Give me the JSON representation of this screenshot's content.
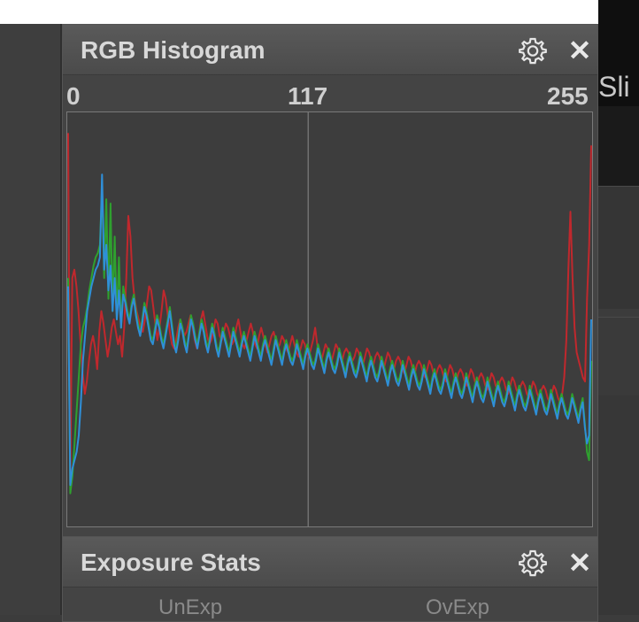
{
  "side_panel": {
    "title": "Sli"
  },
  "histogram_panel": {
    "title": "RGB Histogram",
    "axis": {
      "min": "0",
      "mid": "117",
      "max": "255"
    },
    "icons": {
      "settings": "gear-icon",
      "close": "close-icon"
    },
    "close_glyph": "✕"
  },
  "exposure_panel": {
    "title": "Exposure Stats",
    "close_glyph": "✕",
    "columns": [
      "UnExp",
      "OvExp"
    ]
  },
  "colors": {
    "red": "#c0282d",
    "green": "#2fa02f",
    "blue": "#2f8fd8",
    "grid": "#8a8a8a"
  },
  "chart_data": {
    "type": "line",
    "xlim": [
      0,
      255
    ],
    "x_ticks": [
      0,
      117,
      255
    ],
    "series": [
      {
        "color": "red",
        "values": [
          95,
          10,
          60,
          62,
          58,
          52,
          44,
          37,
          32,
          35,
          40,
          44,
          46,
          43,
          38,
          47,
          52,
          49,
          45,
          41,
          44,
          48,
          50,
          47,
          44,
          46,
          41,
          48,
          60,
          75,
          70,
          60,
          55,
          52,
          50,
          48,
          47,
          50,
          54,
          58,
          57,
          53,
          49,
          45,
          48,
          52,
          57,
          55,
          51,
          47,
          44,
          43,
          45,
          48,
          50,
          48,
          46,
          47,
          49,
          51,
          48,
          45,
          43,
          46,
          50,
          52,
          49,
          46,
          44,
          45,
          47,
          50,
          49,
          46,
          45,
          47,
          49,
          48,
          46,
          44,
          45,
          48,
          50,
          47,
          44,
          43,
          45,
          47,
          49,
          47,
          44,
          43,
          46,
          48,
          46,
          44,
          42,
          44,
          46,
          47,
          45,
          43,
          44,
          46,
          45,
          43,
          42,
          44,
          46,
          44,
          42,
          41,
          43,
          45,
          44,
          42,
          41,
          43,
          45,
          48,
          44,
          42,
          40,
          42,
          44,
          43,
          41,
          40,
          42,
          44,
          43,
          41,
          40,
          42,
          43,
          42,
          41,
          40,
          41,
          43,
          42,
          40,
          39,
          41,
          43,
          42,
          40,
          39,
          41,
          42,
          41,
          39,
          38,
          40,
          42,
          41,
          39,
          38,
          40,
          41,
          40,
          38,
          37,
          39,
          41,
          40,
          38,
          37,
          39,
          40,
          39,
          37,
          36,
          38,
          40,
          39,
          37,
          36,
          38,
          39,
          38,
          36,
          35,
          37,
          39,
          38,
          36,
          35,
          37,
          38,
          37,
          35,
          34,
          36,
          38,
          37,
          35,
          34,
          36,
          37,
          36,
          34,
          33,
          35,
          37,
          36,
          34,
          33,
          35,
          36,
          35,
          33,
          32,
          34,
          36,
          35,
          33,
          32,
          34,
          35,
          34,
          32,
          31,
          33,
          35,
          34,
          32,
          31,
          33,
          34,
          33,
          31,
          30,
          32,
          34,
          33,
          31,
          30,
          32,
          36,
          45,
          62,
          76,
          60,
          48,
          42,
          40,
          38,
          36,
          35,
          55,
          68,
          92
        ]
      },
      {
        "color": "green",
        "values": [
          60,
          8,
          12,
          20,
          28,
          36,
          44,
          48,
          50,
          53,
          57,
          60,
          63,
          65,
          66,
          68,
          82,
          60,
          79,
          55,
          78,
          52,
          70,
          50,
          65,
          48,
          58,
          55,
          52,
          50,
          54,
          56,
          52,
          49,
          47,
          50,
          54,
          52,
          49,
          46,
          45,
          48,
          51,
          49,
          46,
          44,
          47,
          50,
          53,
          49,
          45,
          43,
          46,
          50,
          48,
          45,
          43,
          47,
          51,
          49,
          46,
          44,
          47,
          50,
          48,
          45,
          43,
          46,
          49,
          47,
          44,
          42,
          45,
          48,
          46,
          44,
          42,
          45,
          48,
          46,
          44,
          42,
          45,
          47,
          45,
          43,
          41,
          44,
          47,
          45,
          43,
          41,
          44,
          46,
          44,
          42,
          40,
          43,
          46,
          44,
          42,
          40,
          43,
          45,
          43,
          41,
          40,
          42,
          45,
          43,
          41,
          39,
          42,
          44,
          42,
          40,
          39,
          41,
          44,
          42,
          40,
          38,
          41,
          43,
          41,
          39,
          38,
          40,
          43,
          41,
          39,
          37,
          40,
          42,
          40,
          38,
          37,
          39,
          42,
          40,
          38,
          36,
          39,
          41,
          39,
          37,
          36,
          38,
          41,
          39,
          37,
          35,
          38,
          40,
          38,
          36,
          35,
          37,
          40,
          38,
          36,
          34,
          37,
          39,
          37,
          35,
          34,
          36,
          39,
          37,
          35,
          33,
          36,
          38,
          36,
          34,
          33,
          35,
          38,
          36,
          34,
          32,
          35,
          37,
          35,
          33,
          32,
          34,
          37,
          35,
          33,
          31,
          34,
          36,
          34,
          32,
          31,
          33,
          36,
          34,
          32,
          30,
          33,
          35,
          33,
          31,
          30,
          32,
          35,
          33,
          31,
          29,
          32,
          34,
          32,
          30,
          29,
          31,
          34,
          32,
          30,
          28,
          31,
          33,
          31,
          29,
          28,
          30,
          33,
          31,
          29,
          27,
          30,
          32,
          30,
          28,
          27,
          29,
          32,
          30,
          28,
          26,
          29,
          31,
          25,
          18,
          16,
          40
        ]
      },
      {
        "color": "blue",
        "values": [
          58,
          10,
          14,
          16,
          18,
          22,
          30,
          40,
          46,
          52,
          55,
          58,
          60,
          62,
          63,
          65,
          85,
          62,
          68,
          57,
          63,
          52,
          60,
          50,
          57,
          48,
          56,
          54,
          51,
          49,
          53,
          55,
          51,
          48,
          46,
          49,
          53,
          51,
          48,
          45,
          44,
          47,
          50,
          48,
          45,
          43,
          46,
          49,
          52,
          48,
          44,
          42,
          45,
          49,
          47,
          44,
          42,
          46,
          50,
          48,
          45,
          43,
          46,
          49,
          47,
          44,
          42,
          45,
          48,
          46,
          43,
          41,
          44,
          47,
          45,
          43,
          41,
          44,
          47,
          45,
          43,
          41,
          44,
          46,
          44,
          42,
          40,
          43,
          46,
          44,
          42,
          40,
          43,
          45,
          43,
          41,
          39,
          42,
          45,
          43,
          41,
          39,
          42,
          44,
          42,
          40,
          39,
          41,
          44,
          42,
          40,
          38,
          41,
          43,
          41,
          39,
          38,
          40,
          43,
          41,
          39,
          37,
          40,
          42,
          40,
          38,
          37,
          39,
          42,
          40,
          38,
          36,
          39,
          41,
          39,
          37,
          36,
          38,
          41,
          39,
          37,
          35,
          38,
          40,
          38,
          36,
          35,
          37,
          40,
          38,
          36,
          34,
          37,
          39,
          37,
          35,
          34,
          36,
          39,
          37,
          35,
          33,
          36,
          38,
          36,
          34,
          33,
          35,
          38,
          36,
          34,
          32,
          35,
          37,
          35,
          33,
          32,
          34,
          37,
          35,
          33,
          31,
          34,
          36,
          34,
          32,
          31,
          33,
          36,
          34,
          32,
          30,
          33,
          35,
          33,
          31,
          30,
          32,
          35,
          33,
          31,
          29,
          32,
          34,
          32,
          30,
          29,
          31,
          34,
          32,
          30,
          28,
          31,
          33,
          31,
          29,
          28,
          30,
          33,
          31,
          29,
          27,
          30,
          32,
          30,
          28,
          27,
          29,
          32,
          30,
          28,
          26,
          29,
          31,
          29,
          27,
          26,
          28,
          31,
          29,
          27,
          25,
          28,
          30,
          24,
          20,
          22,
          50
        ]
      }
    ]
  }
}
